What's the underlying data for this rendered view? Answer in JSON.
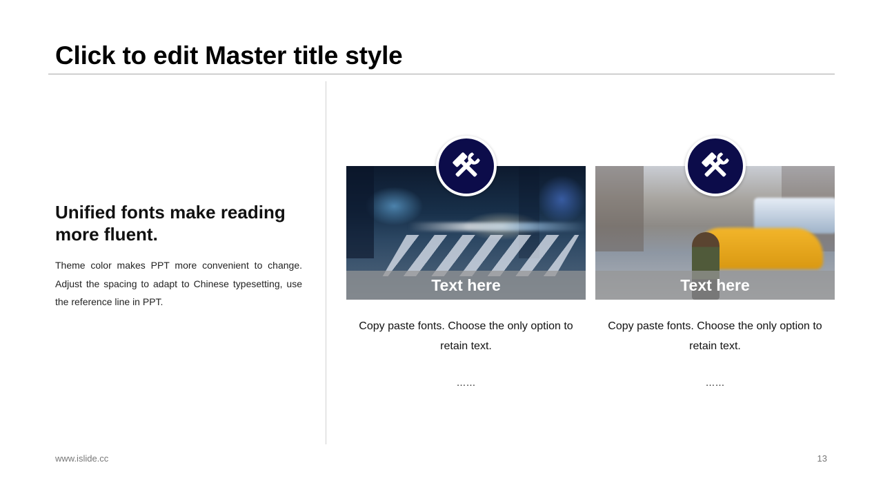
{
  "slide": {
    "title": "Click to edit Master title style",
    "page_number": "13",
    "footer_url": "www.islide.cc"
  },
  "left": {
    "heading": "Unified fonts make reading more fluent.",
    "body": "Theme color makes PPT more convenient to change. Adjust the spacing to adapt to Chinese typesetting, use the reference line in PPT."
  },
  "cards": [
    {
      "icon": "tools-icon",
      "photo": "night-city-crosswalk",
      "caption": "Text here",
      "text": "Copy paste fonts. Choose the only option to retain text.",
      "ellipsis": "……"
    },
    {
      "icon": "tools-icon",
      "photo": "day-city-street-taxi",
      "caption": "Text here",
      "text": "Copy paste fonts. Choose the only option to retain text.",
      "ellipsis": "……"
    }
  ],
  "colors": {
    "accent": "#0c0c4a",
    "caption_bar": "#969696",
    "divider": "#d0d0d0"
  }
}
